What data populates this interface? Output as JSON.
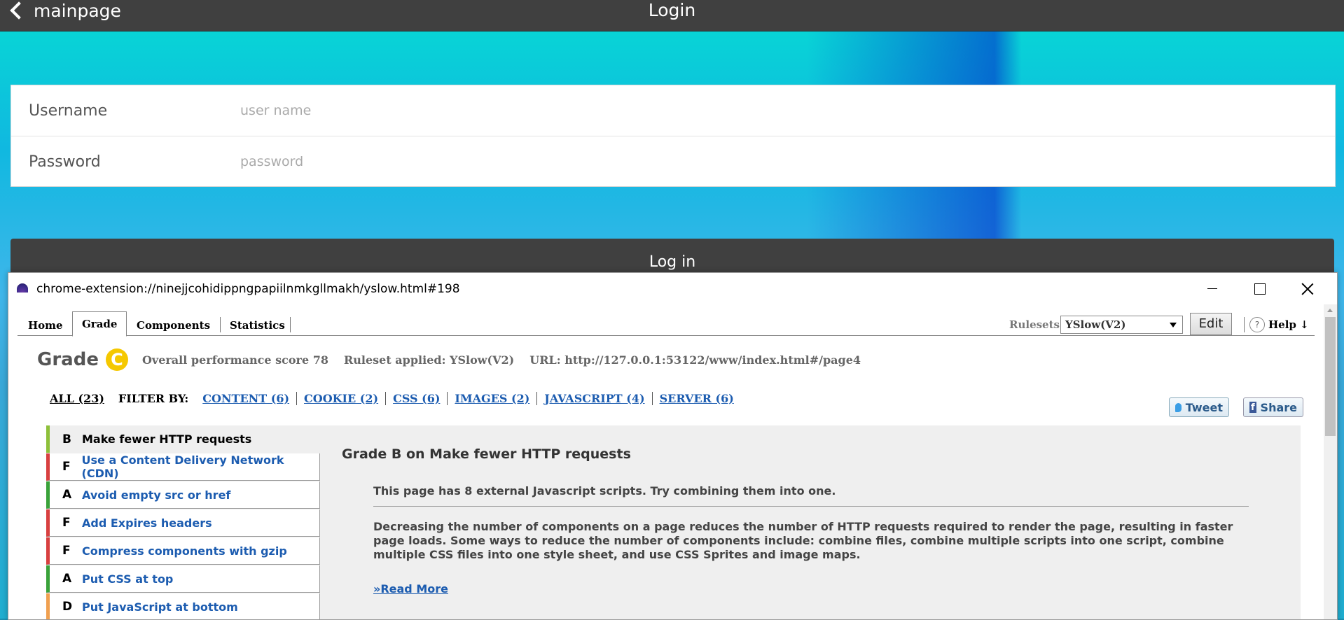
{
  "app": {
    "back_label": "mainpage",
    "title": "Login",
    "form": {
      "username_label": "Username",
      "username_placeholder": "user name",
      "password_label": "Password",
      "password_placeholder": "password"
    },
    "login_button": "Log in"
  },
  "extension": {
    "url": "chrome-extension://ninejjcohidippngpapiilnmkgllmakh/yslow.html#198",
    "tabs": [
      {
        "label": "Home"
      },
      {
        "label": "Grade"
      },
      {
        "label": "Components"
      },
      {
        "label": "Statistics"
      }
    ],
    "active_tab": "Grade",
    "rulesets_label": "Rulesets",
    "ruleset_selected": "YSlow(V2)",
    "edit_label": "Edit",
    "help_icon": "?",
    "help_label": "Help ↓",
    "grade": {
      "title": "Grade",
      "letter": "C",
      "score_text": "Overall performance score 78",
      "ruleset_text": "Ruleset applied: YSlow(V2)",
      "url_text": "URL: http://127.0.0.1:53122/www/index.html#/page4"
    },
    "filters": {
      "all": "ALL (23)",
      "filter_by": "FILTER BY:",
      "items": [
        {
          "label": "CONTENT (6)"
        },
        {
          "label": "COOKIE (2)"
        },
        {
          "label": "CSS (6)"
        },
        {
          "label": "IMAGES (2)"
        },
        {
          "label": "JAVASCRIPT (4)"
        },
        {
          "label": "SERVER (6)"
        }
      ]
    },
    "social": {
      "tweet": "Tweet",
      "share": "Share",
      "fb_glyph": "f"
    },
    "rules": [
      {
        "grade": "B",
        "name": "Make fewer HTTP requests"
      },
      {
        "grade": "F",
        "name": "Use a Content Delivery Network (CDN)"
      },
      {
        "grade": "A",
        "name": "Avoid empty src or href"
      },
      {
        "grade": "F",
        "name": "Add Expires headers"
      },
      {
        "grade": "F",
        "name": "Compress components with gzip"
      },
      {
        "grade": "A",
        "name": "Put CSS at top"
      },
      {
        "grade": "D",
        "name": "Put JavaScript at bottom"
      }
    ],
    "detail": {
      "title": "Grade B on Make fewer HTTP requests",
      "summary": "This page has 8 external Javascript scripts. Try combining them into one.",
      "description": "Decreasing the number of components on a page reduces the number of HTTP requests required to render the page, resulting in faster page loads. Some ways to reduce the number of components include: combine files, combine multiple scripts into one script, combine multiple CSS files into one style sheet, and use CSS Sprites and image maps.",
      "read_more": "»Read More"
    }
  }
}
